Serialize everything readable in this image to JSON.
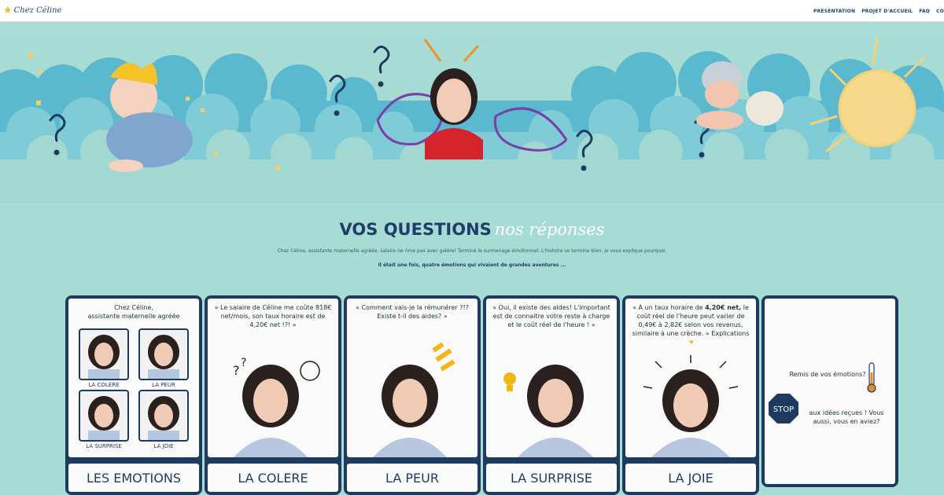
{
  "header": {
    "logo_text": "Chez Céline",
    "nav": [
      "PRESENTATION",
      "PROJET D'ACCUEIL",
      "FAQ",
      "CO"
    ]
  },
  "main": {
    "title_main": "VOS QUESTIONS",
    "title_accent": "nos réponses",
    "intro": "Chez Céline, assistante maternelle agréée, salaire ne rime pas avec galère! Terminé le surmenage émotionnel. L'histoire se termine bien, je vous explique pourquoi.",
    "tagline": "Il était une fois, quatre émotions qui vivaient de grandes aventures ..."
  },
  "cards": [
    {
      "footer": "LES EMOTIONS",
      "quote_l1": "Chez Céline,",
      "quote_l2": "assistante maternelle agréée",
      "emotions": [
        "LA COLERE",
        "LA PEUR",
        "LA SURPRISE",
        "LA JOIE"
      ]
    },
    {
      "footer": "LA COLERE",
      "quote": "« Le salaire de Céline me coûte 818€ net/mois, son taux horaire est de 4,20€ net !?! »"
    },
    {
      "footer": "LA PEUR",
      "quote": "« Comment vais-je la rémunérer ?!? Existe t-il des aides? »"
    },
    {
      "footer": "LA SURPRISE",
      "quote": "« Oui, il existe des aides! L'important est de connaitre votre reste à charge et le coût réel de l'heure ! »"
    },
    {
      "footer": "LA JOIE",
      "quote_a": "« A un taux horaire de ",
      "quote_bold": "4,20€ net,",
      "quote_b": " le coût réel de l'heure peut varier de 0,49€ à 2,82€ selon vos revenus, similaire à une crèche. »",
      "quote_link": "Explications"
    },
    {
      "mood": "Remis de vos émotions?",
      "stop_label": "STOP",
      "stop_text": "aux idées reçues ! Vous aussi, vous en aviez?"
    }
  ],
  "colors": {
    "navy": "#1f3a5f",
    "mint": "#a7dcd4",
    "cloud_blue": "#59b9cf",
    "sun": "#f2d17a"
  }
}
